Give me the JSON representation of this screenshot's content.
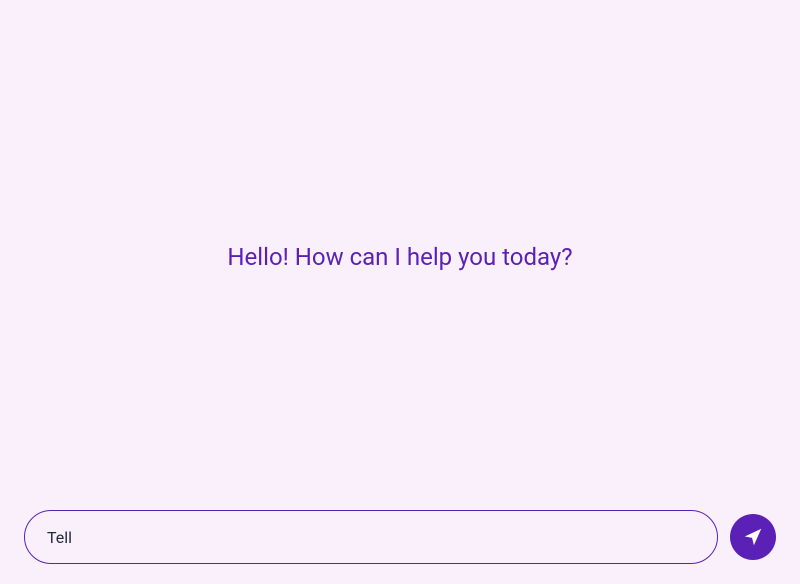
{
  "greeting": "Hello! How can I help you today?",
  "input": {
    "value": "Tell",
    "placeholder": ""
  }
}
